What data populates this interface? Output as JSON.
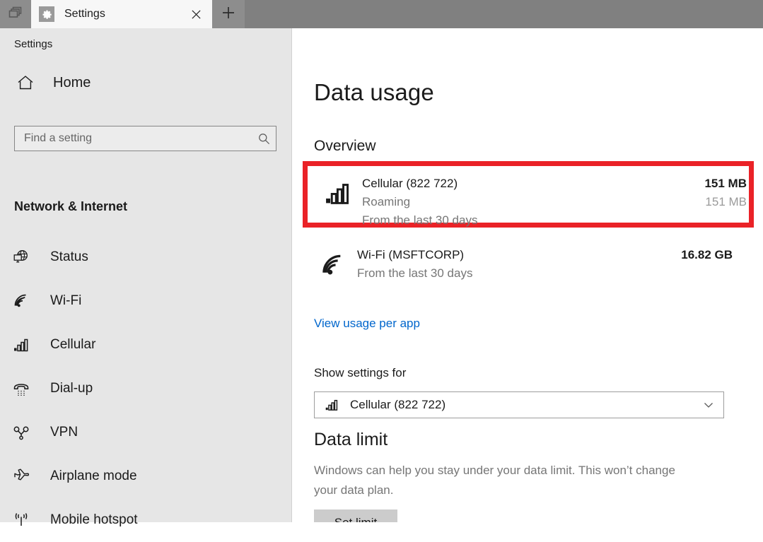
{
  "titlebar": {
    "tablist_icon": "stacked-windows-icon",
    "tab_label": "Settings",
    "tab_favicon": "gear-icon",
    "close_icon": "close-icon",
    "newtab_icon": "plus-icon",
    "bar_color": "#808080"
  },
  "sidebar": {
    "breadcrumb": "Settings",
    "home": {
      "label": "Home",
      "icon": "home-icon"
    },
    "search": {
      "value": "",
      "placeholder": "Find a setting",
      "icon": "search-icon"
    },
    "group_title": "Network & Internet",
    "items": [
      {
        "label": "Status",
        "icon": "globe-monitor-icon"
      },
      {
        "label": "Wi-Fi",
        "icon": "wifi-icon"
      },
      {
        "label": "Cellular",
        "icon": "cellular-bars-icon"
      },
      {
        "label": "Dial-up",
        "icon": "phone-handset-icon"
      },
      {
        "label": "VPN",
        "icon": "vpn-key-icon"
      },
      {
        "label": "Airplane mode",
        "icon": "airplane-icon"
      },
      {
        "label": "Mobile hotspot",
        "icon": "hotspot-broadcast-icon"
      }
    ]
  },
  "main": {
    "page_title": "Data usage",
    "overview": {
      "heading": "Overview",
      "highlight_color": "#ea2227",
      "rows": [
        {
          "icon": "cellular-bars-icon",
          "name": "Cellular (822 722)",
          "sub1": "Roaming",
          "sub2": "From the last 30 days",
          "amount": "151 MB",
          "amount_sub": "151 MB",
          "highlighted": true
        },
        {
          "icon": "wifi-icon",
          "name": "Wi-Fi (MSFTCORP)",
          "sub1": "From the last 30 days",
          "amount": "16.82 GB",
          "highlighted": false
        }
      ],
      "link": "View usage per app",
      "link_color": "#0066cc"
    },
    "show_settings_for": {
      "label": "Show settings for",
      "selected": "Cellular (822 722)",
      "icon": "cellular-bars-icon",
      "chevron": "chevron-down-icon"
    },
    "data_limit": {
      "heading": "Data limit",
      "description": "Windows can help you stay under your data limit. This won’t change your data plan.",
      "button": "Set limit"
    }
  }
}
